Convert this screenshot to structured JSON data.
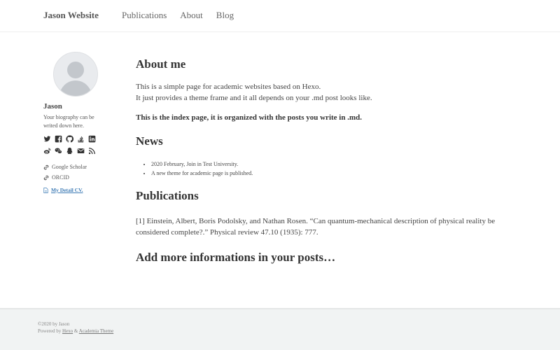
{
  "header": {
    "site_title": "Jason Website",
    "nav": [
      "Publications",
      "About",
      "Blog"
    ]
  },
  "sidebar": {
    "author_name": "Jason",
    "bio": "Your biography can be writed down here.",
    "social_icons": [
      "twitter-icon",
      "facebook-icon",
      "github-icon",
      "stackoverflow-icon",
      "linkedin-icon",
      "weibo-icon",
      "wechat-icon",
      "qq-icon",
      "email-icon",
      "rss-icon"
    ],
    "links": [
      "Google Scholar",
      "ORCID"
    ],
    "cv_label": "My Detail CV."
  },
  "main": {
    "about_heading": "About me",
    "about_line1": "This is a simple page for academic websites based on Hexo.",
    "about_line2": "It just provides a theme frame and it all depends on your .md post looks like.",
    "index_note": "This is the index page, it is organized with the posts you write in .md.",
    "news_heading": "News",
    "news_items": [
      "2020 February, Join in Test University.",
      "A new theme for academic page is published."
    ],
    "pub_heading": "Publications",
    "pub_entry": "[1] Einstein, Albert, Boris Podolsky, and Nathan Rosen. “Can quantum-mechanical description of physical reality be considered complete?.” Physical review 47.10 (1935): 777.",
    "more_heading": "Add more informations in your posts…"
  },
  "footer": {
    "copyright": "©2020 by Jason",
    "powered_by": "Powered by",
    "hexo_link": "Hexo",
    "amp": "&",
    "theme_link": "Academia Theme"
  },
  "colors": {
    "link": "#3d7bb5",
    "footer_bg": "#f1f3f3",
    "text": "#333333"
  }
}
